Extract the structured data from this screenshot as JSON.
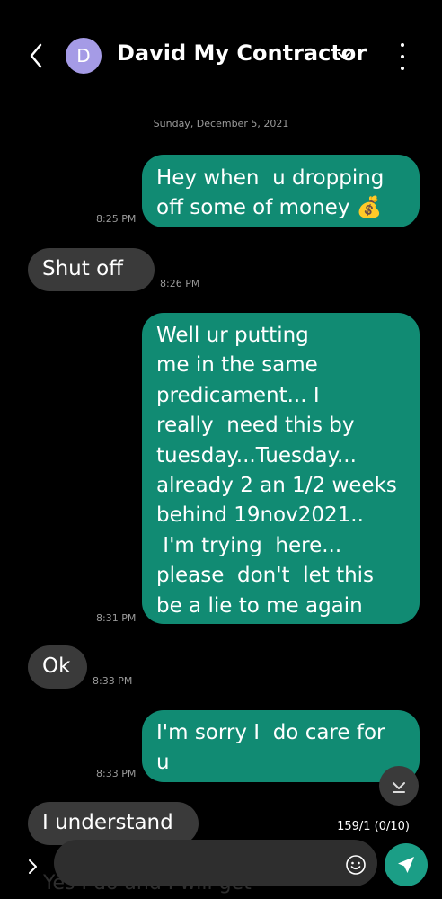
{
  "header": {
    "avatar_initial": "D",
    "contact_name": "David My Contractor"
  },
  "conversation": {
    "date_separator": "Sunday, December 5, 2021",
    "messages": [
      {
        "direction": "outgoing",
        "text": "Hey when  u dropping\noff some of money 💰",
        "time": "8:25 PM"
      },
      {
        "direction": "incoming",
        "text": "Shut off",
        "time": "8:26 PM"
      },
      {
        "direction": "outgoing",
        "text": "Well ur putting\nme in the same\npredicament... I\nreally  need this by\ntuesday...Tuesday...\nalready 2 an 1/2 weeks\nbehind 19nov2021..\n I'm trying  here...\nplease  don't  let this\nbe a lie to me again",
        "time": "8:31 PM"
      },
      {
        "direction": "incoming",
        "text": "Ok",
        "time": "8:33 PM"
      },
      {
        "direction": "outgoing",
        "text": "I'm sorry I  do care for\nu",
        "time": "8:33 PM"
      },
      {
        "direction": "incoming",
        "text": "I understand",
        "time": ""
      }
    ]
  },
  "composer": {
    "counter": "159/1 (0/10)",
    "placeholder": "",
    "partial_text": "Yes I do and I will get"
  },
  "colors": {
    "outgoing_bubble": "#118b73",
    "incoming_bubble": "#3a3a3a",
    "send_button": "#1b9e86",
    "avatar": "#a59be6"
  },
  "icons": {
    "back": "chevron-left-icon",
    "dropdown": "chevron-down-icon",
    "more": "more-vertical-icon",
    "scroll_down": "arrow-down-icon",
    "expand": "chevron-right-icon",
    "emoji": "smiley-icon",
    "send": "send-icon"
  }
}
